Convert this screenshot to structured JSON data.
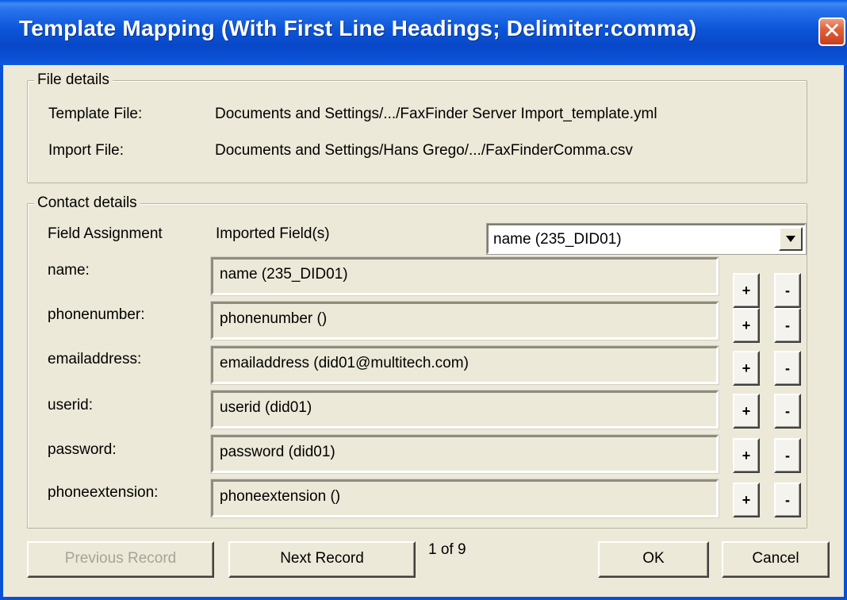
{
  "window": {
    "title": "Template Mapping (With First Line Headings; Delimiter:comma)",
    "close_label": "✕"
  },
  "file_details": {
    "legend": "File details",
    "template_label": "Template File:",
    "template_value": "Documents and Settings/.../FaxFinder Server Import_template.yml",
    "import_label": "Import File:",
    "import_value": "Documents and Settings/Hans Grego/.../FaxFinderComma.csv"
  },
  "contact_details": {
    "legend": "Contact details",
    "field_assignment_header": "Field Assignment",
    "imported_fields_header": "Imported Field(s)",
    "selector_value": "name (235_DID01)",
    "add_label": "+",
    "remove_label": "-",
    "rows": [
      {
        "label": "name:",
        "value": "name (235_DID01)"
      },
      {
        "label": "phonenumber:",
        "value": "phonenumber ()"
      },
      {
        "label": "emailaddress:",
        "value": "emailaddress (did01@multitech.com)"
      },
      {
        "label": "userid:",
        "value": "userid (did01)"
      },
      {
        "label": "password:",
        "value": "password (did01)"
      },
      {
        "label": "phoneextension:",
        "value": "phoneextension ()"
      }
    ]
  },
  "footer": {
    "previous_label": "Previous Record",
    "next_label": "Next Record",
    "record_counter": "1 of 9",
    "ok_label": "OK",
    "cancel_label": "Cancel"
  },
  "colors": {
    "title_bar": "#0A50D5",
    "dialog_bg": "#ECE9D8",
    "close_button": "#D8532E"
  }
}
